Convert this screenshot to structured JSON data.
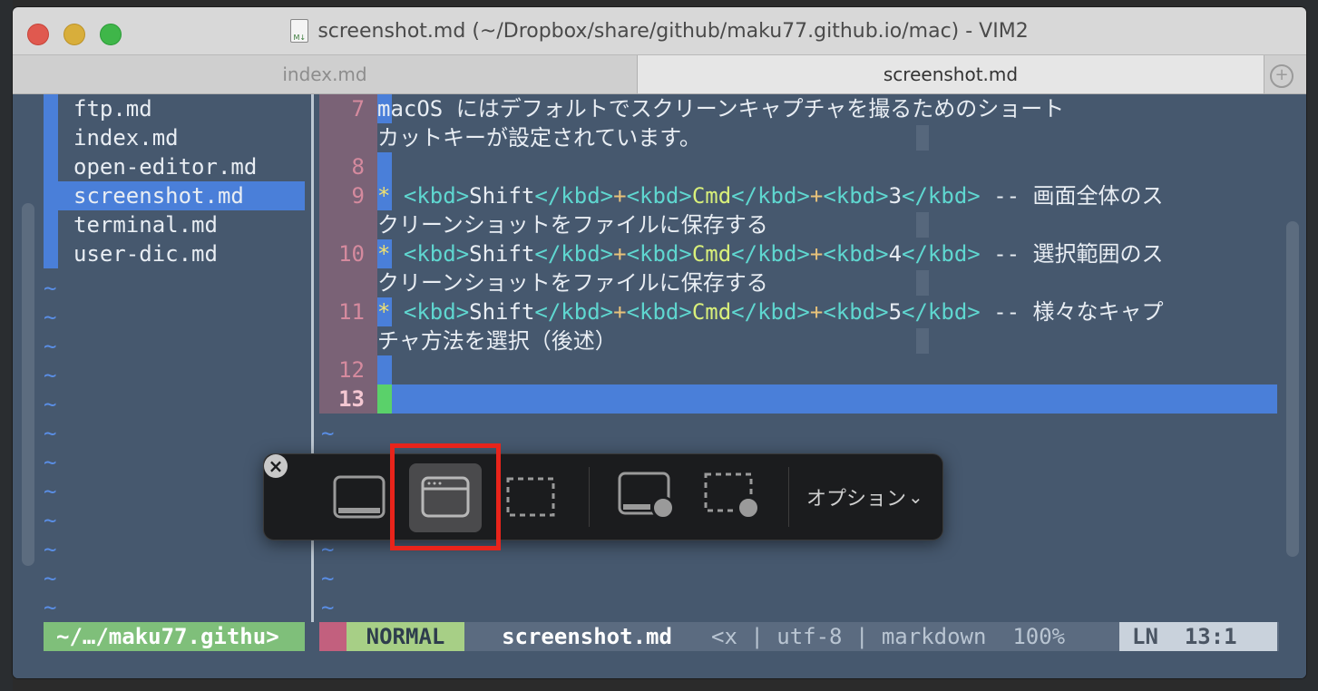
{
  "window": {
    "title": "screenshot.md (~/Dropbox/share/github/maku77.github.io/mac) - VIM2",
    "tabs": [
      {
        "label": "index.md",
        "active": false
      },
      {
        "label": "screenshot.md",
        "active": true
      }
    ],
    "tab_add_label": "+"
  },
  "nerdtree": {
    "files": [
      "ftp.md",
      "index.md",
      "open-editor.md",
      "screenshot.md",
      "terminal.md",
      "user-dic.md"
    ],
    "selected": "screenshot.md",
    "tilde": "~"
  },
  "editor": {
    "line_numbers": [
      "7",
      "8",
      "9",
      "10",
      "11",
      "12",
      "13"
    ],
    "line7a": "macOS にはデフォルトでスクリーンキャプチャを撮るためのショート",
    "line7b": "カットキーが設定されています。",
    "bullet": "*",
    "kbd_open": "<kbd>",
    "kbd_close": "</kbd>",
    "plus": "+",
    "shift": "Shift",
    "cmd": "Cmd",
    "key3": "3",
    "key4": "4",
    "key5": "5",
    "dash": "--",
    "line9_tail": "画面全体のス",
    "line9b": "クリーンショットをファイルに保存する",
    "line10_tail": "選択範囲のス",
    "line10b": "クリーンショットをファイルに保存する",
    "line11_tail": "様々なキャプ",
    "line11b": "チャ方法を選択（後述）",
    "tilde": "~"
  },
  "statusbar": {
    "path": "~/…/maku77.githu>",
    "mode": "NORMAL",
    "file": "screenshot.md",
    "rest": "<x | utf-8 | markdown  100% ",
    "ln_label": "LN",
    "position": "13:1"
  },
  "capture_toolbar": {
    "close_glyph": "×",
    "options_label": "オプション",
    "options_chevron": "⌄",
    "selected_tool": "capture-window"
  },
  "colors": {
    "editor_bg": "#46586e",
    "accent_blue": "#4a7fd9",
    "highlight_red": "#e8241b",
    "mode_green": "#a7cf86"
  }
}
